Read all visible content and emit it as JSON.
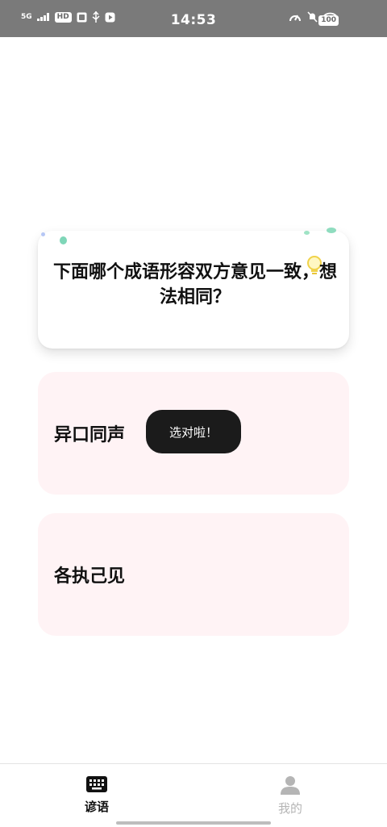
{
  "status_bar": {
    "signal": "5G",
    "hd_badge": "HD",
    "time": "14:53",
    "battery": "100"
  },
  "quiz": {
    "question": "下面哪个成语形容双方意见一致，想法相同？",
    "options": [
      {
        "label": "异口同声"
      },
      {
        "label": "各执己见"
      }
    ],
    "toast": "选对啦！"
  },
  "bottom_nav": {
    "items": [
      {
        "label": "谚语",
        "icon": "keyboard-icon",
        "active": true
      },
      {
        "label": "我的",
        "icon": "person-icon",
        "active": false
      }
    ]
  },
  "colors": {
    "option_bg": "#fff3f5",
    "toast_bg": "#1b1b1b",
    "status_bar_bg": "#7a7a7a",
    "nav_inactive": "#b5b5b5"
  }
}
